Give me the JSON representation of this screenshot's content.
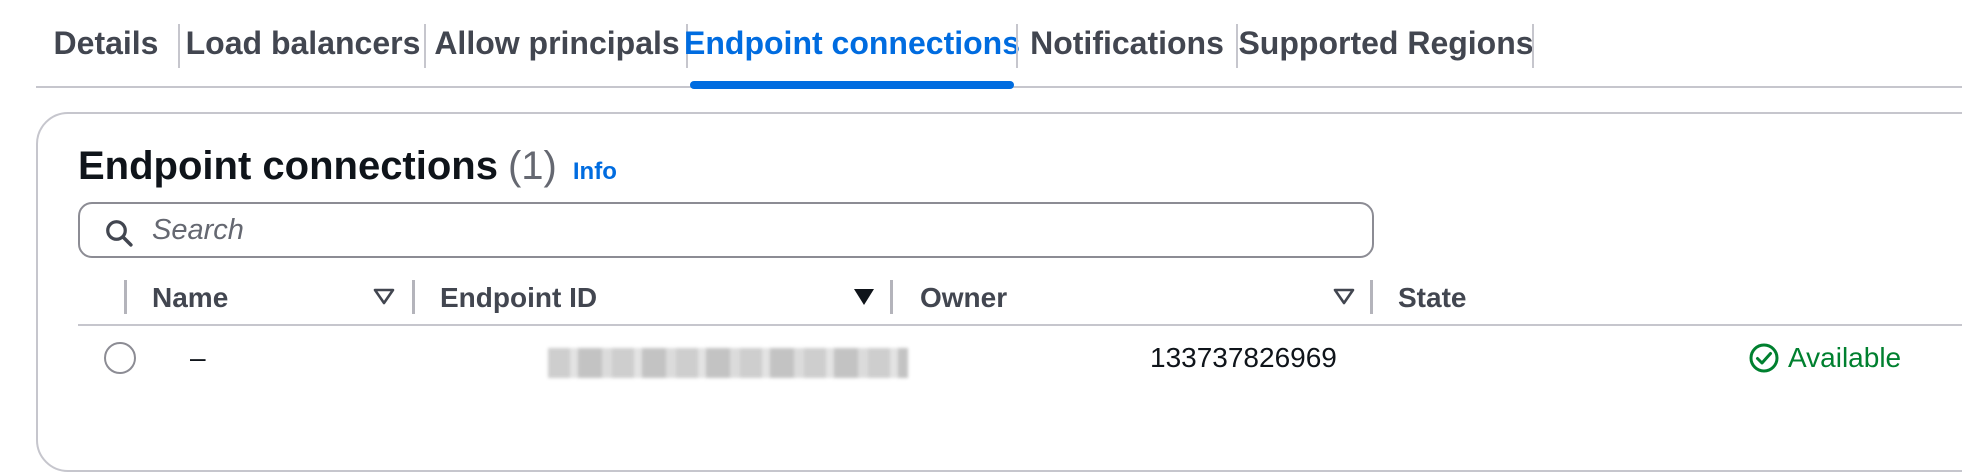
{
  "tabs": [
    {
      "label": "Details"
    },
    {
      "label": "Load balancers"
    },
    {
      "label": "Allow principals"
    },
    {
      "label": "Endpoint connections",
      "active": true
    },
    {
      "label": "Notifications"
    },
    {
      "label": "Supported Regions"
    }
  ],
  "panel": {
    "title": "Endpoint connections",
    "count": "(1)",
    "info_label": "Info"
  },
  "search": {
    "placeholder": "Search",
    "value": ""
  },
  "table": {
    "columns": [
      {
        "label": "Name",
        "sort_icon": "sort-caret-down-outline-icon"
      },
      {
        "label": "Endpoint ID",
        "sort_icon": "sort-caret-down-filled-icon",
        "sorted": true
      },
      {
        "label": "Owner",
        "sort_icon": "sort-caret-down-outline-icon"
      },
      {
        "label": "State"
      }
    ],
    "rows": [
      {
        "name": "–",
        "endpoint_id": "",
        "owner": "133737826969",
        "state": "Available",
        "state_icon": "check-circle-icon"
      }
    ]
  },
  "colors": {
    "accent": "#006ce0",
    "success": "#00802f",
    "text": "#0f141a",
    "muted": "#424650",
    "border": "#c6c6cd"
  }
}
